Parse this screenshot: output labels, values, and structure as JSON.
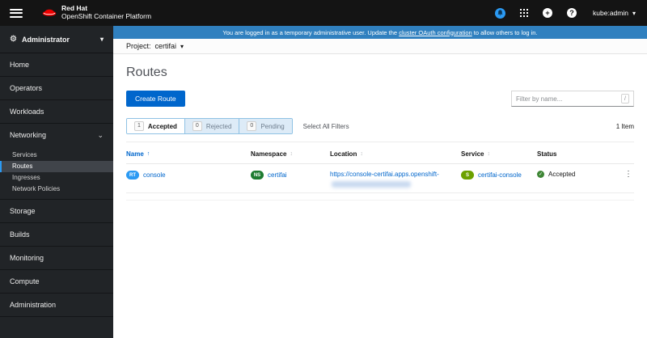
{
  "colors": {
    "accent": "#0066cc",
    "masthead_bg": "#141414",
    "sidebar_bg": "#212427",
    "banner_bg": "#3080bf",
    "nav_active_indicator": "#2b9af3",
    "badge_route": "#2b9af3",
    "badge_namespace": "#1e7b31",
    "badge_service": "#6ca100",
    "status_success": "#3e8635"
  },
  "icons": {
    "plus": "+",
    "question": "?",
    "kebab": "⋮",
    "check": "✓",
    "caret_down": "▾",
    "chevron_down": "⌄",
    "gear": "⚙",
    "sort": "↕",
    "sort_asc": "↑"
  },
  "masthead": {
    "brand_line1": "Red Hat",
    "brand_line2": "OpenShift Container Platform",
    "user": "kube:admin"
  },
  "banner": {
    "text_before": "You are logged in as a temporary administrative user. Update the ",
    "link_text": "cluster OAuth configuration",
    "text_after": " to allow others to log in."
  },
  "sidebar": {
    "perspective": "Administrator",
    "items": [
      "Home",
      "Operators",
      "Workloads",
      "Networking",
      "Storage",
      "Builds",
      "Monitoring",
      "Compute",
      "Administration"
    ],
    "networking_children": [
      "Services",
      "Routes",
      "Ingresses",
      "Network Policies"
    ],
    "active_item": "Routes"
  },
  "project_bar": {
    "label": "Project:",
    "value": "certifai"
  },
  "page": {
    "title": "Routes",
    "create_button": "Create Route",
    "filter_placeholder": "Filter by name...",
    "filter_shortcut": "/",
    "filters": [
      {
        "count": "1",
        "label": "Accepted",
        "selected": true
      },
      {
        "count": "0",
        "label": "Rejected",
        "selected": false
      },
      {
        "count": "0",
        "label": "Pending",
        "selected": false
      }
    ],
    "select_all": "Select All Filters",
    "item_count": "1 Item"
  },
  "table": {
    "columns": [
      "Name",
      "Namespace",
      "Location",
      "Service",
      "Status"
    ],
    "rows": [
      {
        "name": {
          "badge": "RT",
          "text": "console"
        },
        "namespace": {
          "badge": "NS",
          "text": "certifai"
        },
        "location": {
          "text": "https://console-certifai.apps.openshift-"
        },
        "service": {
          "badge": "S",
          "text": "certifai-console"
        },
        "status": {
          "label": "Accepted"
        }
      }
    ]
  }
}
